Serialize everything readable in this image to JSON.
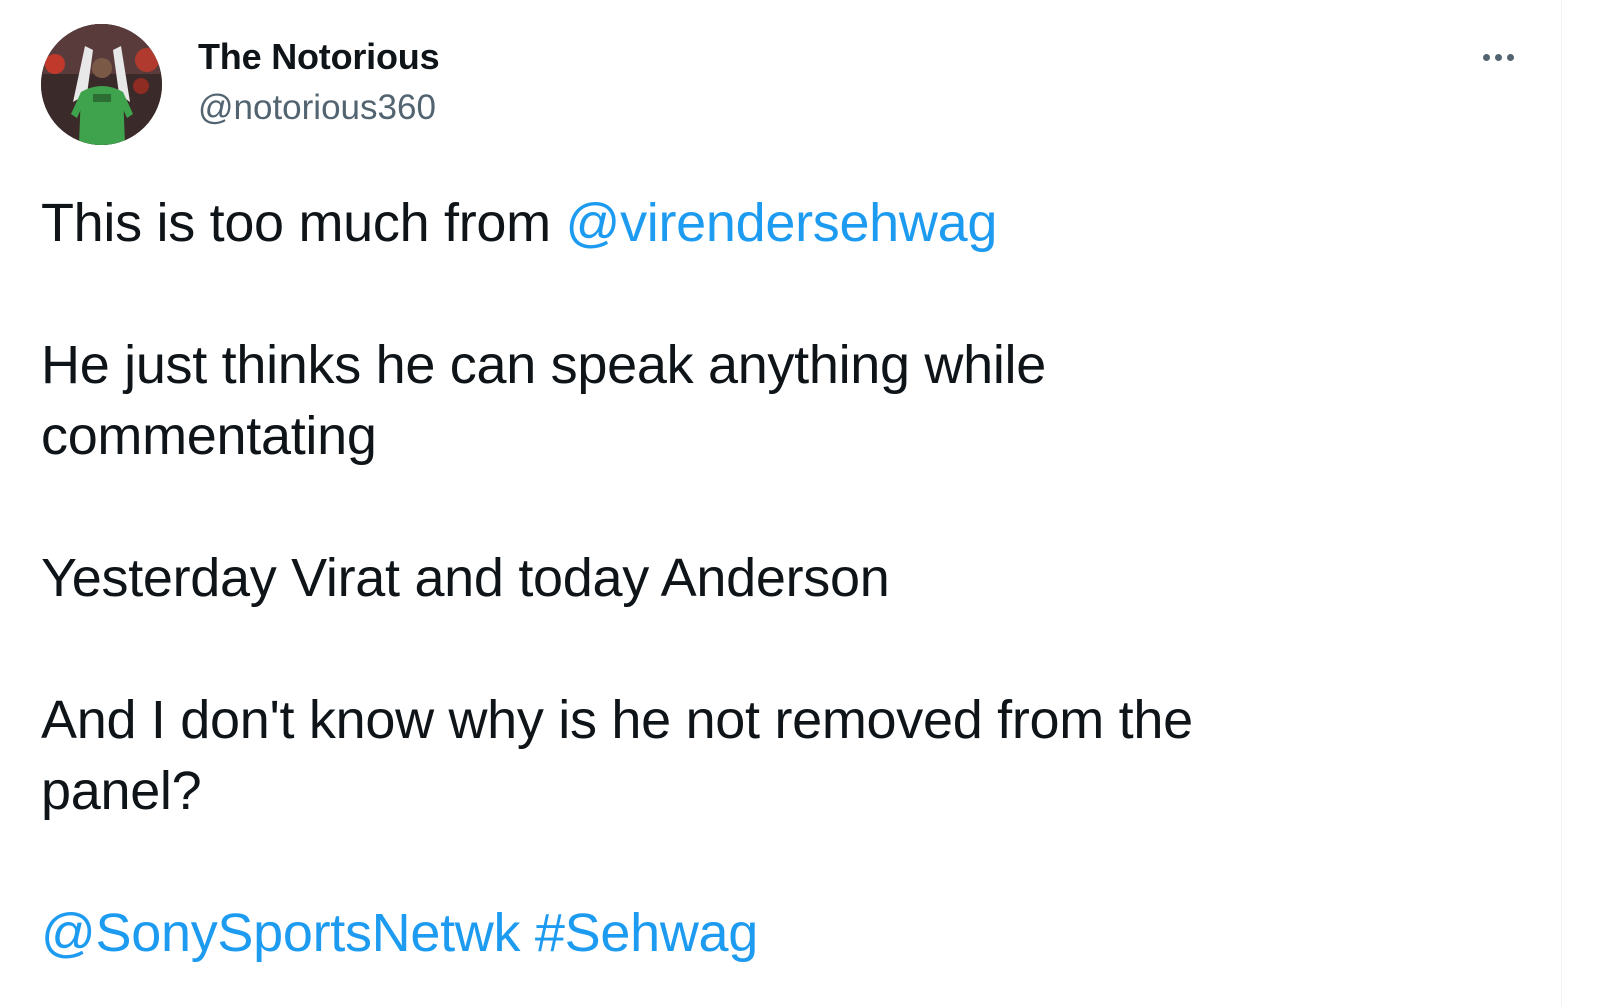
{
  "author": {
    "display_name": "The Notorious",
    "handle": "@notorious360"
  },
  "menu": {
    "icon": "more-horizontal-icon"
  },
  "tweet": {
    "p1_text": "This is too much from ",
    "p1_mention": "@virendersehwag",
    "p2_line1": "He just thinks he can speak anything while",
    "p2_line2": "commentating",
    "p3_text": "Yesterday Virat and today Anderson",
    "p4_line1": "And I don't know why is he not removed from the",
    "p4_line2": "panel?",
    "mention2": "@SonySportsNetwk",
    "hashtag": "#Sehwag"
  },
  "colors": {
    "link": "#1d9bf0",
    "text": "#0f1419",
    "secondary": "#536471"
  }
}
